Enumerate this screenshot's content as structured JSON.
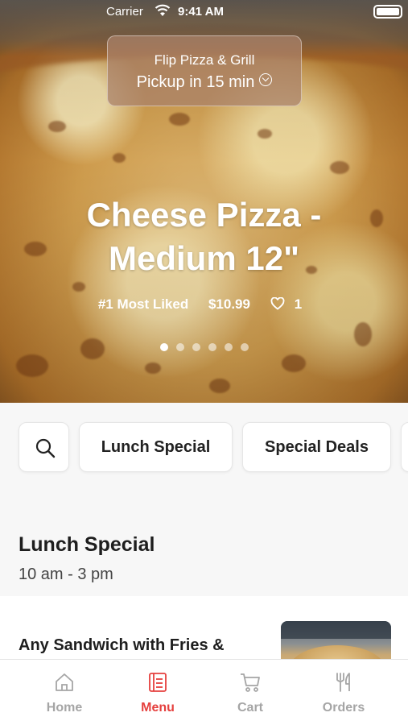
{
  "status_bar": {
    "carrier": "Carrier",
    "time": "9:41 AM"
  },
  "hero": {
    "store_name": "Flip Pizza & Grill",
    "pickup_eta": "Pickup in 15 min",
    "item_title": "Cheese Pizza - Medium 12\"",
    "badge": "#1 Most Liked",
    "price": "$10.99",
    "likes": "1",
    "carousel_total": 6,
    "carousel_active": 1
  },
  "categories": [
    {
      "label": "Lunch Special"
    },
    {
      "label": "Special Deals"
    }
  ],
  "section": {
    "title": "Lunch Special",
    "hours": "10 am - 3 pm"
  },
  "items": [
    {
      "name": "Any Sandwich with Fries &"
    }
  ],
  "tabbar": {
    "tabs": [
      {
        "label": "Home",
        "icon": "home-icon"
      },
      {
        "label": "Menu",
        "icon": "menu-icon",
        "active": true
      },
      {
        "label": "Cart",
        "icon": "cart-icon"
      },
      {
        "label": "Orders",
        "icon": "orders-icon"
      }
    ]
  },
  "colors": {
    "accent": "#e5403e",
    "inactive": "#a5a5a5",
    "background": "#f7f7f7"
  }
}
